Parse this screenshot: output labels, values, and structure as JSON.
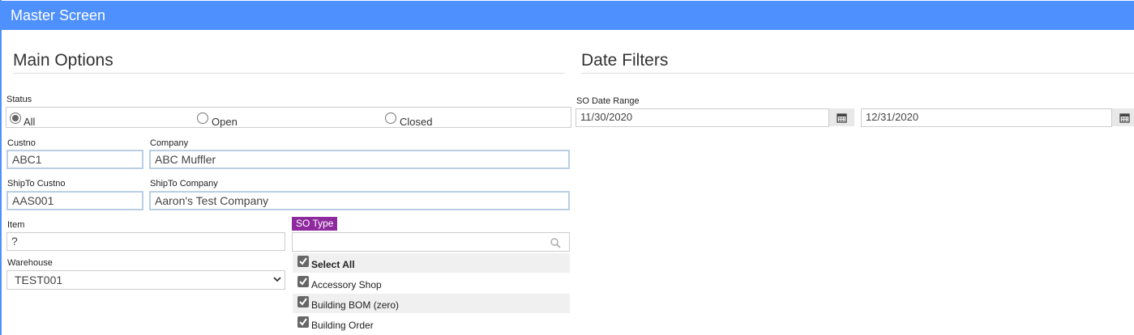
{
  "window": {
    "title": "Master Screen"
  },
  "main_options": {
    "heading": "Main Options",
    "status": {
      "label": "Status",
      "options": [
        {
          "label": "All",
          "selected": true
        },
        {
          "label": "Open",
          "selected": false
        },
        {
          "label": "Closed",
          "selected": false
        }
      ]
    },
    "custno": {
      "label": "Custno",
      "value": "ABC1"
    },
    "company": {
      "label": "Company",
      "value": "ABC Muffler"
    },
    "shipto_custno": {
      "label": "ShipTo Custno",
      "value": "AAS001"
    },
    "shipto_company": {
      "label": "ShipTo Company",
      "value": "Aaron's Test Company"
    },
    "item": {
      "label": "Item",
      "value": "?"
    },
    "warehouse": {
      "label": "Warehouse",
      "value": "TEST001"
    },
    "so_type": {
      "label": "SO Type",
      "search_value": "",
      "options": [
        {
          "label": "Select All",
          "checked": true
        },
        {
          "label": "Accessory Shop",
          "checked": true
        },
        {
          "label": "Building BOM (zero)",
          "checked": true
        },
        {
          "label": "Building Order",
          "checked": true
        }
      ]
    }
  },
  "date_filters": {
    "heading": "Date Filters",
    "so_date_range": {
      "label": "SO Date Range",
      "start": "11/30/2020",
      "end": "12/31/2020"
    }
  },
  "icons": {
    "calendar": "calendar-icon",
    "search": "search-icon",
    "check": "check-icon",
    "chevron": "chevron-down-icon"
  },
  "colors": {
    "header": "#4d90fe",
    "so_type_badge": "#8e2a9e",
    "input_border": "#b9cfe5"
  }
}
